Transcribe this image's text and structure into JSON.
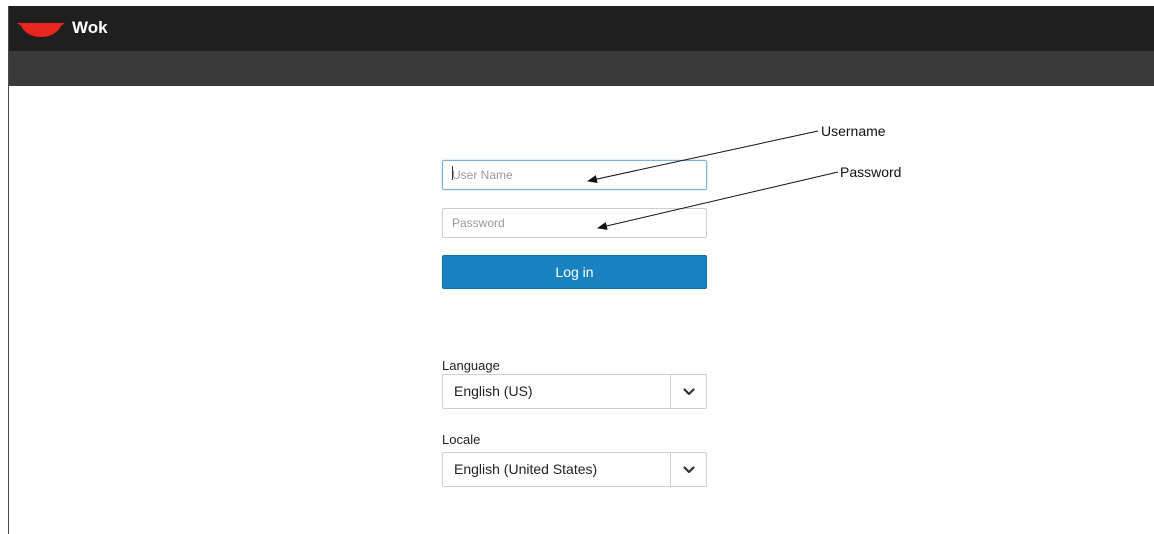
{
  "header": {
    "app_name": "Wok",
    "logo_icon": "wok-icon",
    "logo_color": "#e8251f"
  },
  "login": {
    "username_placeholder": "User Name",
    "password_placeholder": "Password",
    "login_label": "Log in"
  },
  "language": {
    "label": "Language",
    "selected": "English (US)"
  },
  "locale": {
    "label": "Locale",
    "selected": "English (United States)"
  },
  "annotations": {
    "username": "Username",
    "password": "Password"
  },
  "colors": {
    "topbar": "#1f1f1f",
    "subbar": "#3a3a3a",
    "accent": "#1983c1"
  }
}
